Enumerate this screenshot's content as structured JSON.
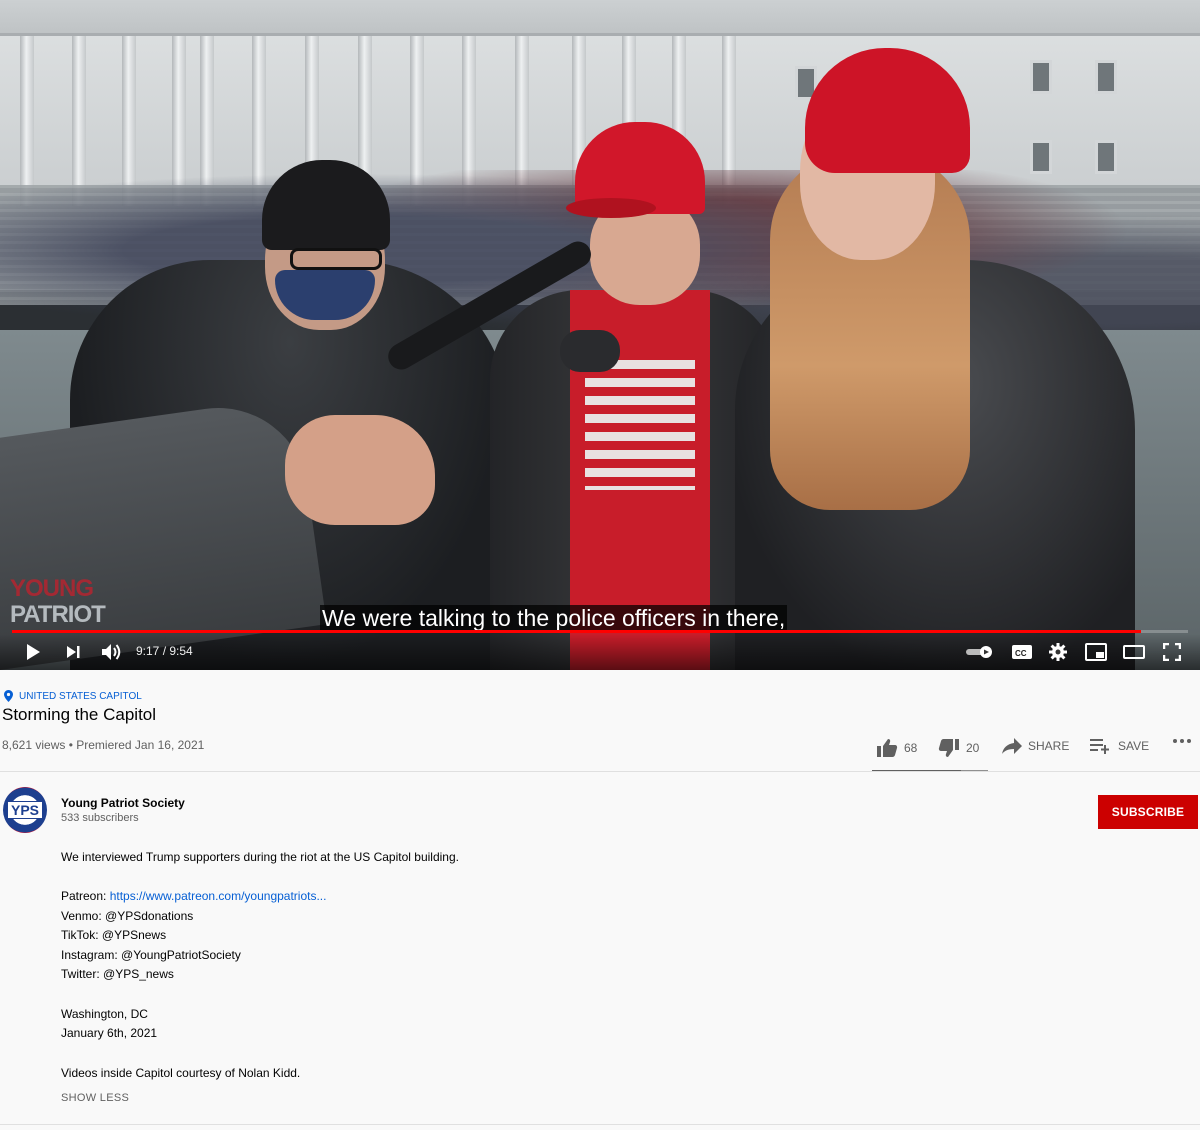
{
  "player": {
    "watermark_line1": "YOUNG",
    "watermark_line2": "PATRIOT",
    "caption": "We were talking to the police officers in there,",
    "time": "9:17 / 9:54",
    "progress": 0.96,
    "icons": [
      "play-icon",
      "next-icon",
      "volume-icon",
      "autoplay-toggle-icon",
      "captions-icon",
      "settings-icon",
      "miniplayer-icon",
      "theater-mode-icon",
      "fullscreen-icon"
    ]
  },
  "video": {
    "location": "UNITED STATES CAPITOL",
    "title": "Storming the Capitol",
    "meta": "8,621 views • Premiered Jan 16, 2021",
    "likes": "68",
    "dislikes": "20",
    "share_label": "SHARE",
    "save_label": "SAVE",
    "like_ratio": 0.77
  },
  "channel": {
    "avatar_text": "YPS",
    "name": "Young Patriot Society",
    "subscribers": "533 subscribers",
    "subscribe_label": "SUBSCRIBE"
  },
  "description": {
    "intro": "We interviewed Trump supporters during the riot at the US Capitol building.",
    "patreon_label": "Patreon: ",
    "patreon_link": "https://www.patreon.com/youngpatriots...",
    "venmo": "Venmo: @YPSdonations",
    "tiktok": "TikTok: @YPSnews",
    "instagram": "Instagram: @YoungPatriotSociety",
    "twitter": "Twitter: @YPS_news",
    "place": "Washington, DC",
    "date": "January 6th, 2021",
    "credit": "Videos inside Capitol courtesy of Nolan Kidd.",
    "show_less": "SHOW LESS"
  },
  "colors": {
    "accent_red": "#cc0000",
    "link_blue": "#065fd4",
    "meta_gray": "#606060"
  }
}
